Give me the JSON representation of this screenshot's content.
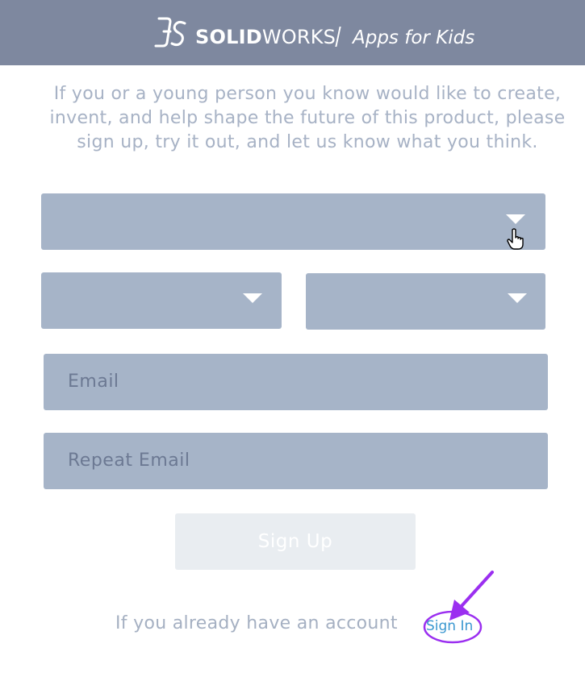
{
  "header": {
    "brand_bold": "SOLID",
    "brand_light": "WORKS",
    "tagline": "Apps for Kids",
    "background": "#7e889f"
  },
  "intro_text": "If you or a young person you know would like to create, invent, and help shape the future of this product, please sign up, try it out, and let us know what you think.",
  "form": {
    "select_1": {
      "selected": ""
    },
    "select_2": {
      "selected": ""
    },
    "select_3": {
      "selected": ""
    },
    "email_placeholder": "Email",
    "repeat_email_placeholder": "Repeat Email",
    "signup_label": "Sign Up",
    "field_color": "#a6b4c8"
  },
  "footer": {
    "account_text": "If you already have an account",
    "signin_label": "Sign In",
    "link_color": "#3a97d0"
  },
  "annotation": {
    "highlight_color": "#9b2ff0",
    "icons": [
      "arrow-annotation-icon",
      "circle-highlight-icon",
      "hand-cursor-icon"
    ]
  }
}
